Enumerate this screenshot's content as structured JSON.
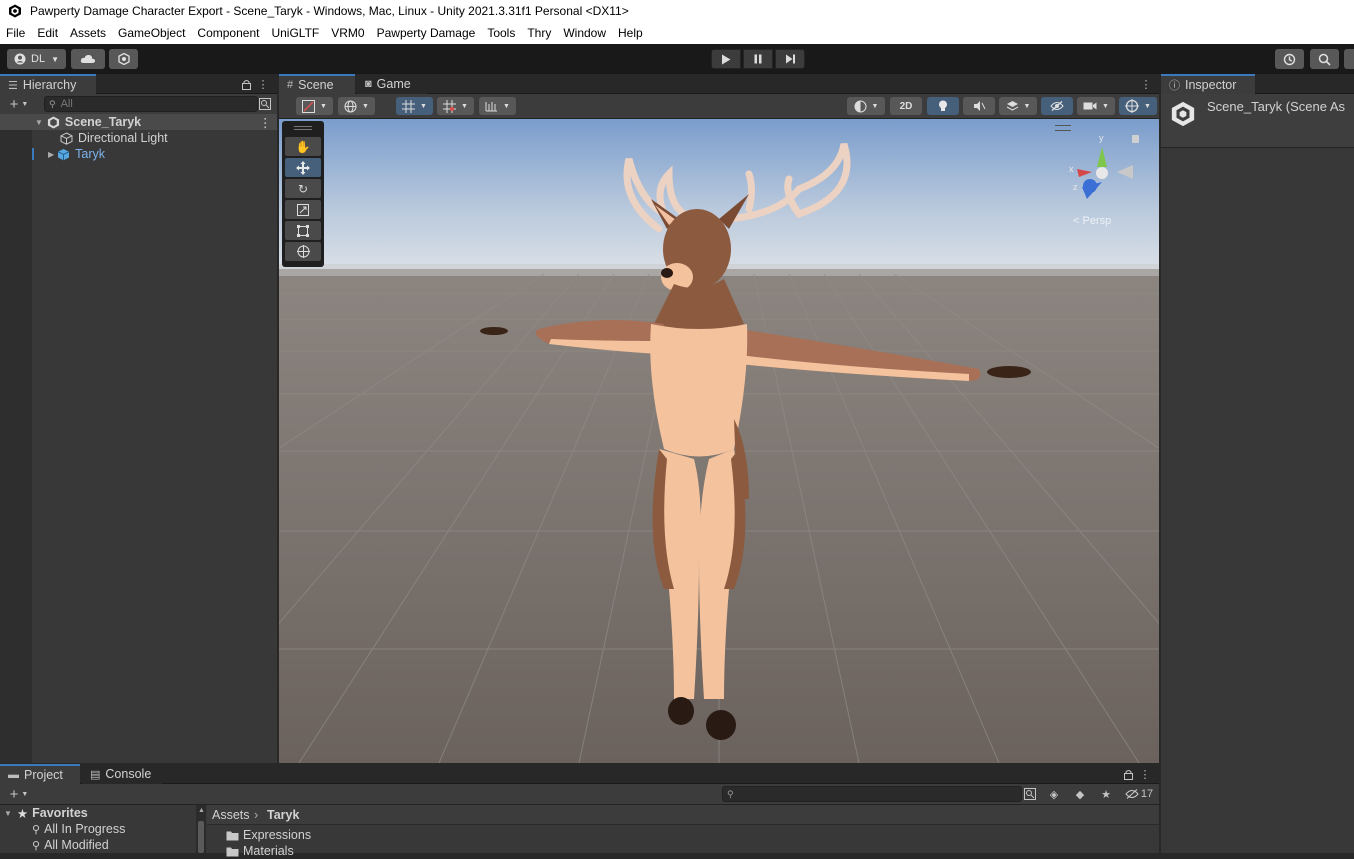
{
  "window": {
    "title": "Pawperty Damage Character Export - Scene_Taryk - Windows, Mac, Linux - Unity 2021.3.31f1 Personal <DX11>"
  },
  "menu": [
    "File",
    "Edit",
    "Assets",
    "GameObject",
    "Component",
    "UniGLTF",
    "VRM0",
    "Pawperty Damage",
    "Tools",
    "Thry",
    "Window",
    "Help"
  ],
  "toolbar": {
    "account_label": "DL",
    "colors": {
      "accent": "#3a79bb",
      "selected": "#46607c",
      "bg": "#191919"
    }
  },
  "hierarchy": {
    "tab_label": "Hierarchy",
    "search_placeholder": "All",
    "scene_name": "Scene_Taryk",
    "items": [
      {
        "label": "Directional Light"
      },
      {
        "label": "Taryk"
      }
    ]
  },
  "scene": {
    "tabs": [
      {
        "label": "Scene"
      },
      {
        "label": "Game"
      }
    ],
    "mode_2d_label": "2D",
    "gizmo": {
      "projection_label": "< Persp",
      "axis_x": "x",
      "axis_y": "y",
      "axis_z": "z"
    }
  },
  "inspector": {
    "tab_label": "Inspector",
    "object_name": "Scene_Taryk (Scene As"
  },
  "project": {
    "tabs": [
      {
        "label": "Project"
      },
      {
        "label": "Console"
      }
    ],
    "favorites_label": "Favorites",
    "favorites": [
      "All In Progress",
      "All Modified"
    ],
    "breadcrumb": [
      "Assets",
      "Taryk"
    ],
    "folders": [
      "Expressions",
      "Materials"
    ],
    "hidden_count": "17"
  }
}
